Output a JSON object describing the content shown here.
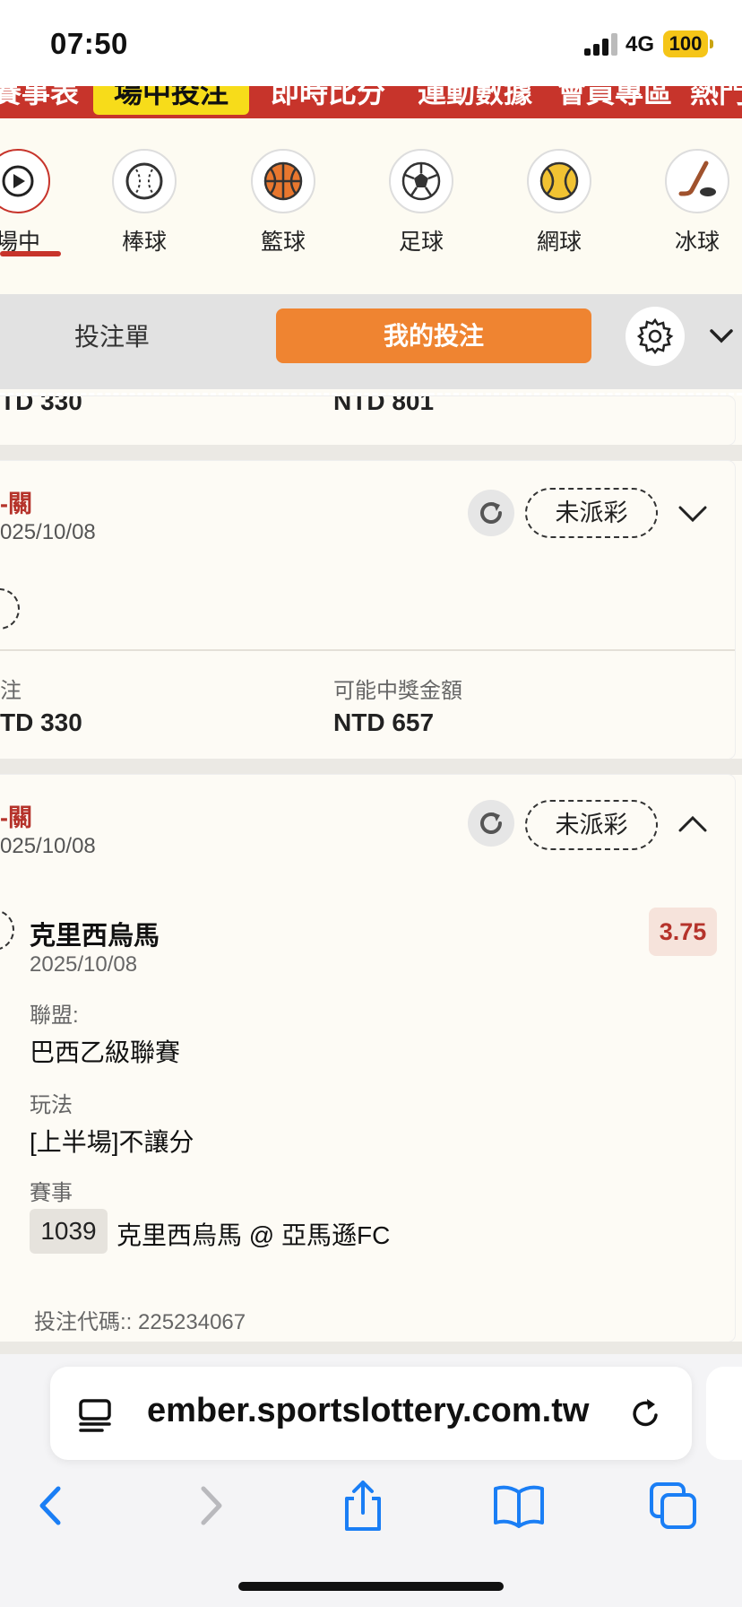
{
  "status_bar": {
    "time": "07:50",
    "network": "4G",
    "battery": "100"
  },
  "ticker": {
    "items": [
      "賽事表",
      "場中投注",
      "即時比分",
      "運動數據",
      "會員專區",
      "熱門"
    ],
    "highlight": "場中投注"
  },
  "sports": [
    {
      "label": "場中",
      "icon": "live-broadcast-icon",
      "selected": true
    },
    {
      "label": "棒球",
      "icon": "baseball-icon"
    },
    {
      "label": "籃球",
      "icon": "basketball-icon"
    },
    {
      "label": "足球",
      "icon": "soccer-ball-icon"
    },
    {
      "label": "網球",
      "icon": "tennis-ball-icon"
    },
    {
      "label": "冰球",
      "icon": "ice-hockey-icon"
    }
  ],
  "bet_tabs": {
    "betslip": "投注單",
    "my_bets": "我的投注"
  },
  "partial_card": {
    "stake": "TD 330",
    "potential": "NTD 801"
  },
  "card1": {
    "type": "-關",
    "date": "025/10/08",
    "status": "未派彩",
    "stake_label": "注",
    "stake": "TD 330",
    "potential_label": "可能中獎金額",
    "potential": "NTD 657"
  },
  "card2": {
    "type": "-關",
    "date": "025/10/08",
    "status": "未派彩",
    "selection": {
      "team": "克里西烏馬",
      "date": "2025/10/08",
      "odds": "3.75",
      "league_label": "聯盟:",
      "league": "巴西乙級聯賽",
      "market_label": "玩法",
      "market": "[上半場]不讓分",
      "event_label": "賽事",
      "event_code": "1039",
      "event_name": "克里西烏馬 @ 亞馬遜FC"
    },
    "bet_code": "投注代碼:: 225234067"
  },
  "browser": {
    "url": "ember.sportslottery.com.tw"
  },
  "colors": {
    "brand_red": "#c7342b",
    "accent_orange": "#ef8431",
    "highlight_yellow": "#f7dc1a",
    "ios_blue": "#1a7ef5"
  }
}
